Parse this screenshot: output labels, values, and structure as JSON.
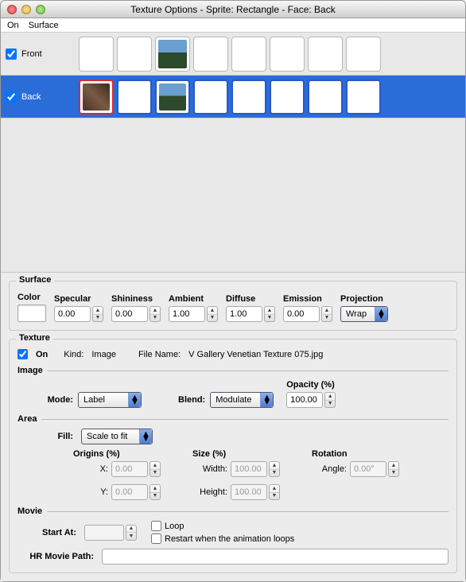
{
  "title": "Texture Options - Sprite: Rectangle - Face: Back",
  "menubar": {
    "on": "On",
    "surface_menu": "Surface"
  },
  "faces": {
    "front": {
      "label": "Front",
      "checked": true
    },
    "back": {
      "label": "Back",
      "checked": true
    }
  },
  "surface": {
    "legend": "Surface",
    "color_label": "Color",
    "specular_label": "Specular",
    "specular": "0.00",
    "shininess_label": "Shininess",
    "shininess": "0.00",
    "ambient_label": "Ambient",
    "ambient": "1.00",
    "diffuse_label": "Diffuse",
    "diffuse": "1.00",
    "emission_label": "Emission",
    "emission": "0.00",
    "projection_label": "Projection",
    "projection": "Wrap"
  },
  "texture": {
    "legend": "Texture",
    "on_checked": true,
    "on_label": "On",
    "kind_label": "Kind:",
    "kind": "Image",
    "filename_label": "File Name:",
    "filename": "V Gallery Venetian Texture 075.jpg",
    "image_head": "Image",
    "mode_label": "Mode:",
    "mode": "Label",
    "blend_label": "Blend:",
    "blend": "Modulate",
    "opacity_label": "Opacity (%)",
    "opacity": "100.00",
    "area_head": "Area",
    "fill_label": "Fill:",
    "fill": "Scale to fit",
    "origins_head": "Origins (%)",
    "size_head": "Size (%)",
    "rotation_head": "Rotation",
    "x_label": "X:",
    "x": "0.00",
    "y_label": "Y:",
    "y": "0.00",
    "width_label": "Width:",
    "width": "100.00",
    "height_label": "Height:",
    "height": "100.00",
    "angle_label": "Angle:",
    "angle": "0.00°",
    "movie_head": "Movie",
    "startat_label": "Start At:",
    "startat": "",
    "loop_label": "Loop",
    "restart_label": "Restart when the animation loops",
    "hrpath_label": "HR Movie Path:",
    "hrpath": ""
  }
}
